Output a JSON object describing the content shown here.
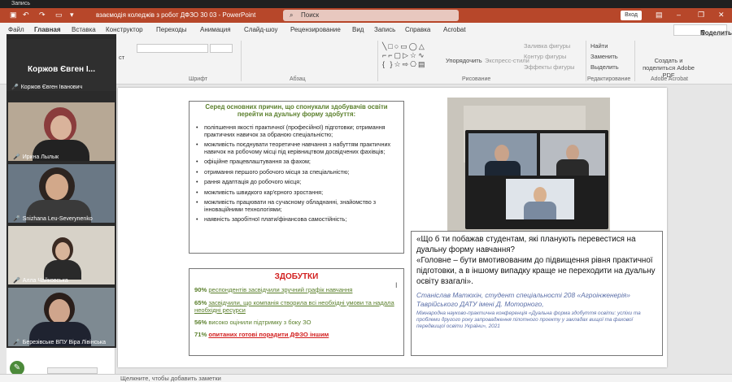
{
  "recording": {
    "label": "Запись"
  },
  "titlebar": {
    "title": "взаємодія коледжів з робот ДФЗО 30 03  -  PowerPoint",
    "search": "Поиск",
    "signin": "Вход"
  },
  "menu": {
    "tabs": [
      "Файл",
      "Главная",
      "Вставка",
      "Конструктор",
      "Переходы",
      "Анимация",
      "Слайд-шоу",
      "Рецензирование",
      "Вид",
      "Запись",
      "Справка",
      "Acrobat"
    ],
    "share": "Поделиться"
  },
  "ribbon": {
    "groups": [
      "Шрифт",
      "Абзац",
      "Рисование",
      "Редактирование",
      "Adobe Acrobat"
    ],
    "arrange": "Упорядочить",
    "quick_styles": "Экспресс-стили",
    "fill": "Заливка фигуры",
    "outline": "Контур фигуры",
    "effects": "Эффекты фигуры",
    "find": "Найти",
    "replace": "Заменить",
    "select": "Выделить",
    "pdf": "Создать и поделиться Adobe PDF",
    "cut": "ст"
  },
  "participants": [
    {
      "name": "Коржов Євген Іванович",
      "header": "Коржов Євген І..."
    },
    {
      "name": "Ирина Лылык"
    },
    {
      "name": "Snizhana Leu-Severynenko"
    },
    {
      "name": "Алла Чайковська"
    },
    {
      "name": "Березівське ВПУ   Віра Лівінська"
    }
  ],
  "slide": {
    "box1_title": "Серед основних причин, що спонукали здобувачів освіти перейти на дуальну форму здобуття:",
    "bullets": [
      "поліпшення якості практичної (професійної) підготовки; отримання практичних навичок за обраною спеціальністю;",
      "можливість поєднувати теоретичне навчання з набуттям практичних навичок на робочому місці під керівництвом досвідчених фахівців;",
      "офіційне працевлаштування за фахом;",
      "отримання першого робочого місця за спеціальністю;",
      "рання адаптація до робочого місця;",
      "можливість швидкого кар'єрного зростання;",
      "можливість працювати на сучасному обладнанні, знайомство з інноваційними технологіями;",
      "наявність заробітної плати/фінансова самостійність;"
    ],
    "achievements_title": "ЗДОБУТКИ",
    "ach": [
      {
        "pct": "90%",
        "text": "респондентів засвідчили зручний графік навчання"
      },
      {
        "pct": "65%",
        "text": "засвідчили, що компанія створила всі необхідні умови та надала необхідні ресурси"
      },
      {
        "pct": "56%",
        "text": "високо оцінили підтримку з боку ЗО"
      },
      {
        "pct": "71%",
        "text": "опитаних готові порадити ДФЗО іншим"
      }
    ],
    "quote1": "«Що б ти побажав студентам, які планують перевестися на дуальну форму навчання?",
    "quote2": " «Головне – бути вмотивованим до підвищення рівня практичної підготовки, а в іншому випадку краще не переходити на дуальну освіту взагалі».",
    "author": "Станіслав Матюхін, студент спеціальності 208 «Агроінженерія» Таврійського ДАТУ імені Д. Моторного,",
    "source": "Міжнародна науково-практична конференція «Дуальна форма здобуття освіти: успіхи та проблеми другого року запровадження пілотного проекту у закладах вищої та фахової передвищої освіти України», 2021"
  },
  "notes": {
    "placeholder": "Щелкните, чтобы добавить заметки"
  }
}
